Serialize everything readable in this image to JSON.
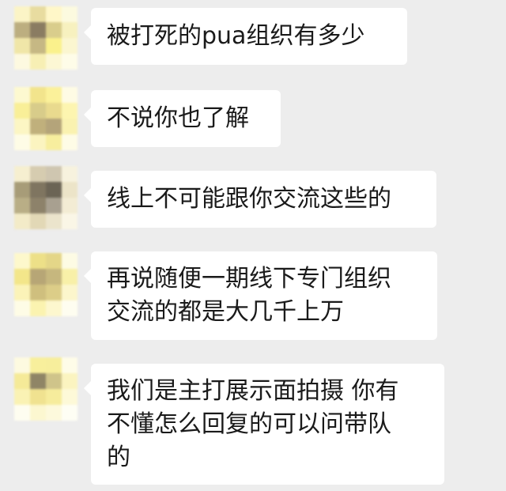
{
  "chat": {
    "background": "#ededed",
    "bubble_color": "#ffffff",
    "messages": [
      {
        "sender": "blurred-avatar",
        "lines": [
          "被打死的pua组织有多少"
        ]
      },
      {
        "sender": "blurred-avatar",
        "lines": [
          "不说你也了解"
        ]
      },
      {
        "sender": "blurred-avatar",
        "lines": [
          "线上不可能跟你交流这些的"
        ]
      },
      {
        "sender": "blurred-avatar",
        "lines": [
          "再说随便一期线下专门组织",
          "交流的都是大几千上万"
        ]
      },
      {
        "sender": "blurred-avatar",
        "lines": [
          "我们是主打展示面拍摄 你有",
          "不懂怎么回复的可以问带队",
          "的"
        ]
      }
    ]
  }
}
